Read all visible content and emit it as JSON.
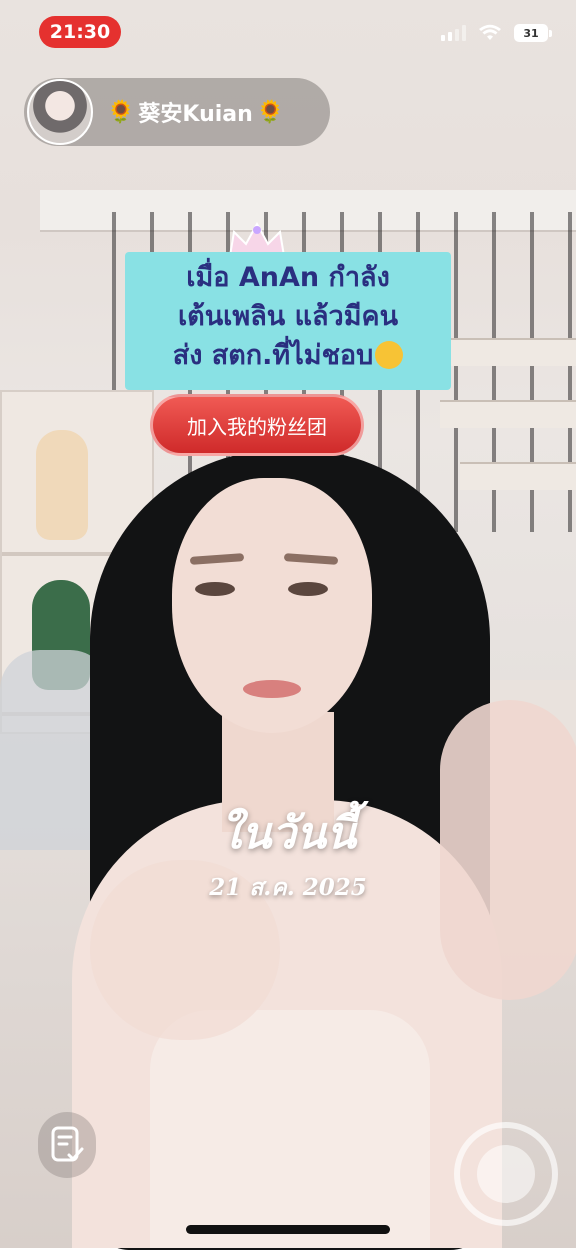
{
  "status_bar": {
    "time": "21:30",
    "battery": "31"
  },
  "streamer": {
    "name": "葵安Kuian",
    "sunflower_left": "🌻",
    "sunflower_right": "🌻"
  },
  "caption": {
    "line1": "เมื่อ AnAn กำลัง",
    "line2": "เต้นเพลิน แล้วมีคน",
    "line3": "ส่ง สตก.ที่ไม่ชอบ"
  },
  "fan_club_button": "加入我的粉丝团",
  "overlay": {
    "title": "ในวันนี้",
    "date": "21 ส.ค. 2025"
  },
  "colors": {
    "time_pill": "#e5312f",
    "caption_bg": "#89e1e4",
    "caption_text": "#2a2f80",
    "fan_button": "#d9302f"
  }
}
